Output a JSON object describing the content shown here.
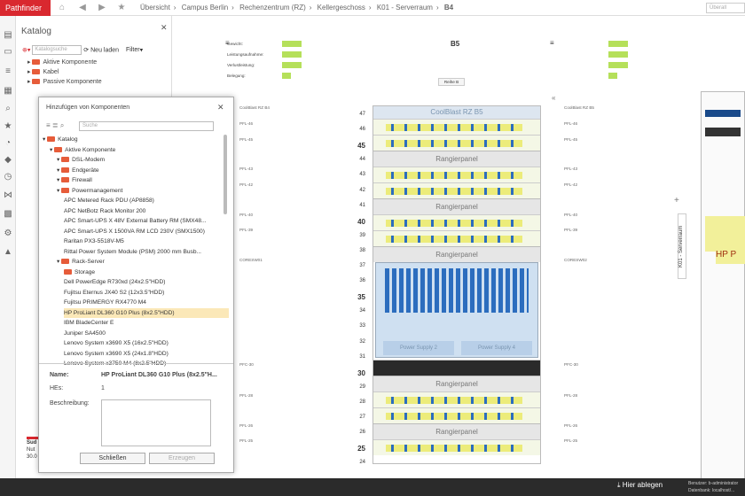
{
  "app": {
    "title": "Pathfinder",
    "search_placeholder": "Überall"
  },
  "breadcrumb": [
    "Übersicht",
    "Campus Berlin",
    "Rechenzentrum (RZ)",
    "Kellergeschoss",
    "K01 - Serverraum",
    "B4"
  ],
  "catalog": {
    "title": "Katalog",
    "search_placeholder": "Katalogsuche",
    "reload": "Neu laden",
    "filter": "Filter",
    "items": [
      "Aktive Komponente",
      "Kabel",
      "Passive Komponente"
    ]
  },
  "dialog": {
    "title": "Hinzufügen von Komponenten",
    "search_placeholder": "Suche",
    "tree": [
      {
        "label": "Katalog",
        "level": 0
      },
      {
        "label": "Aktive Komponente",
        "level": 1
      },
      {
        "label": "DSL-Modem",
        "level": 2
      },
      {
        "label": "Endgeräte",
        "level": 2
      },
      {
        "label": "Firewall",
        "level": 2
      },
      {
        "label": "Powermanagement",
        "level": 2
      },
      {
        "label": "APC Metered Rack PDU (AP8858)",
        "level": 3
      },
      {
        "label": "APC NetBotz Rack Monitor 200",
        "level": 3
      },
      {
        "label": "APC Smart-UPS X 48V External Battery RM (SMX48...",
        "level": 3
      },
      {
        "label": "APC Smart-UPS X 1500VA RM LCD 230V (SMX1500)",
        "level": 3
      },
      {
        "label": "Raritan PX3-5518V-M5",
        "level": 3
      },
      {
        "label": "Rittal Power System Module (PSM) 2000 mm Busb...",
        "level": 3
      },
      {
        "label": "Rack-Server",
        "level": 2
      },
      {
        "label": "Storage",
        "level": 3
      },
      {
        "label": "Dell PowerEdge R730xd (24x2.5\"HDD)",
        "level": 3
      },
      {
        "label": "Fujitsu Eternus JX40 S2 (12x3.5\"HDD)",
        "level": 3
      },
      {
        "label": "Fujitsu PRIMERGY RX4770 M4",
        "level": 3
      },
      {
        "label": "HP ProLiant DL360 G10 Plus (8x2.5\"HDD)",
        "level": 3
      },
      {
        "label": "IBM BladeCenter E",
        "level": 3
      },
      {
        "label": "Juniper SA4500",
        "level": 3
      },
      {
        "label": "Lenovo System x3690 X5 (16x2.5\"HDD)",
        "level": 3
      },
      {
        "label": "Lenovo System x3690 X5 (24x1.8\"HDD)",
        "level": 3
      },
      {
        "label": "Lenovo System x3750 M4 (8x2.5\"HDD)",
        "level": 3
      }
    ],
    "name_label": "Name:",
    "name_value": "HP ProLiant DL360 G10 Plus (8x2.5\"H...",
    "he_label": "HEs:",
    "he_value": "1",
    "desc_label": "Beschreibung:",
    "close": "Schließen",
    "create": "Erzeugen"
  },
  "rack": {
    "title": "B5",
    "row": "Reihe B",
    "left_rack": "K01 - Serverraum",
    "coolblast": "CoolBlast RZ B5",
    "server": "Power Supply 2",
    "server2": "Power Supply 4",
    "patch": "Rangierpanel",
    "numbers": [
      "47",
      "46",
      "45",
      "44",
      "43",
      "42",
      "41",
      "40",
      "39",
      "38",
      "37",
      "36",
      "35",
      "34",
      "33",
      "32",
      "31",
      "30",
      "29",
      "28",
      "27",
      "26",
      "25",
      "24"
    ],
    "info_labels": [
      "Gewicht:",
      "Leistungsaufnahme:",
      "Verlustleistung:",
      "Belegung:"
    ],
    "left_items": [
      "CoolBlast RZ B4",
      "PFL-46",
      "PFL-45",
      "PFL-43",
      "PFL-42",
      "PFL-40",
      "PFL-39",
      "CORESW01",
      "PFC-30",
      "PFL-28",
      "PFL-26",
      "PFL-25"
    ],
    "right_items": [
      "CoolBlast RZ B5",
      "PFL-46",
      "PFL-45",
      "PFL-43",
      "PFL-42",
      "PFL-40",
      "PFL-39",
      "CORESW02",
      "PFC-30",
      "PFL-28",
      "PFL-26",
      "PFL-25"
    ]
  },
  "sideleft": {
    "label": "Sud",
    "sub": "Nut",
    "num": "30.0"
  },
  "hint": {
    "text": "Hier ablegen"
  },
  "user": {
    "line1": "Benutzer: b-administrator",
    "line2": "Datenbank: localhost/..."
  },
  "rightpanel": {
    "text": "HP P"
  }
}
